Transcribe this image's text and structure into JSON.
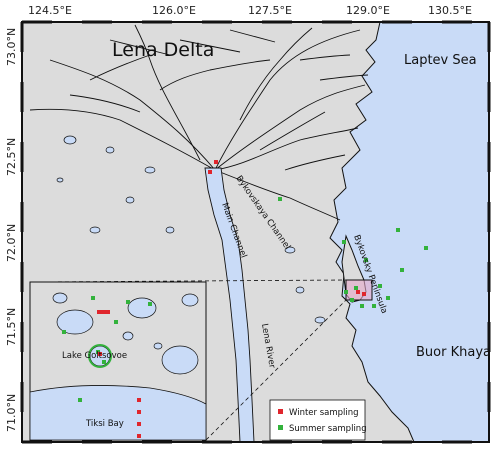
{
  "map": {
    "title": "Lena Delta",
    "sea_labels": [
      "Laptev Sea",
      "Buor Khaya"
    ],
    "feature_labels": {
      "bykovskaya_channel": "Bykovskaya Channel",
      "main_channel": "Main Channel",
      "bykovsky_peninsula": "Bykovsky Peninsula",
      "lena_river": "Lena River",
      "lake": "Lake Goltsovoe",
      "bay": "Tiksi Bay"
    },
    "lon_ticks": [
      "124.5°E",
      "126.0°E",
      "127.5°E",
      "129.0°E",
      "130.5°E"
    ],
    "lat_ticks": [
      "73.0°N",
      "72.5°N",
      "72.0°N",
      "71.5°N",
      "71.0°N"
    ],
    "legend": {
      "winter": "Winter sampling",
      "summer": "Summer sampling"
    },
    "colors": {
      "land": "#dcdcdc",
      "water": "#c9dbf7",
      "winter": "#e0262d",
      "summer": "#33b23c",
      "inset_highlight": "#e6a9c9"
    }
  }
}
